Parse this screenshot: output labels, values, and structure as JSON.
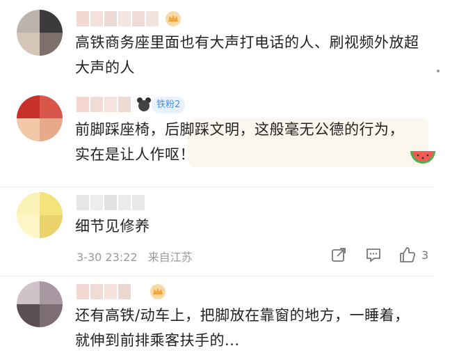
{
  "comments": [
    {
      "text_lines": [
        "高铁商务座里面也有大声打电话的人、刷视频外放超",
        "大声的人"
      ],
      "badge_icon": "crown-badge-icon"
    },
    {
      "text_lines": [
        "前脚踩座椅，后脚踩文明，这般毫无公德的行为，",
        "实在是让人作呕！"
      ],
      "fan_badge": "铁粉2",
      "sticker_icon": "watermelon-icon"
    },
    {
      "text_lines": [
        "细节见修养"
      ],
      "time": "3-30 23:22",
      "location": "来自江苏",
      "like_count": "3"
    },
    {
      "text_lines": [
        "还有高铁/动车上，把脚放在靠窗的地方，一睡着，",
        "就伸到前排乘客扶手的..."
      ],
      "badge_icon": "crown-badge-icon"
    }
  ],
  "colors": {
    "accent": "#4a90e2",
    "badge_gold": "#f4a63a",
    "meta_gray": "#9a9a9a"
  }
}
